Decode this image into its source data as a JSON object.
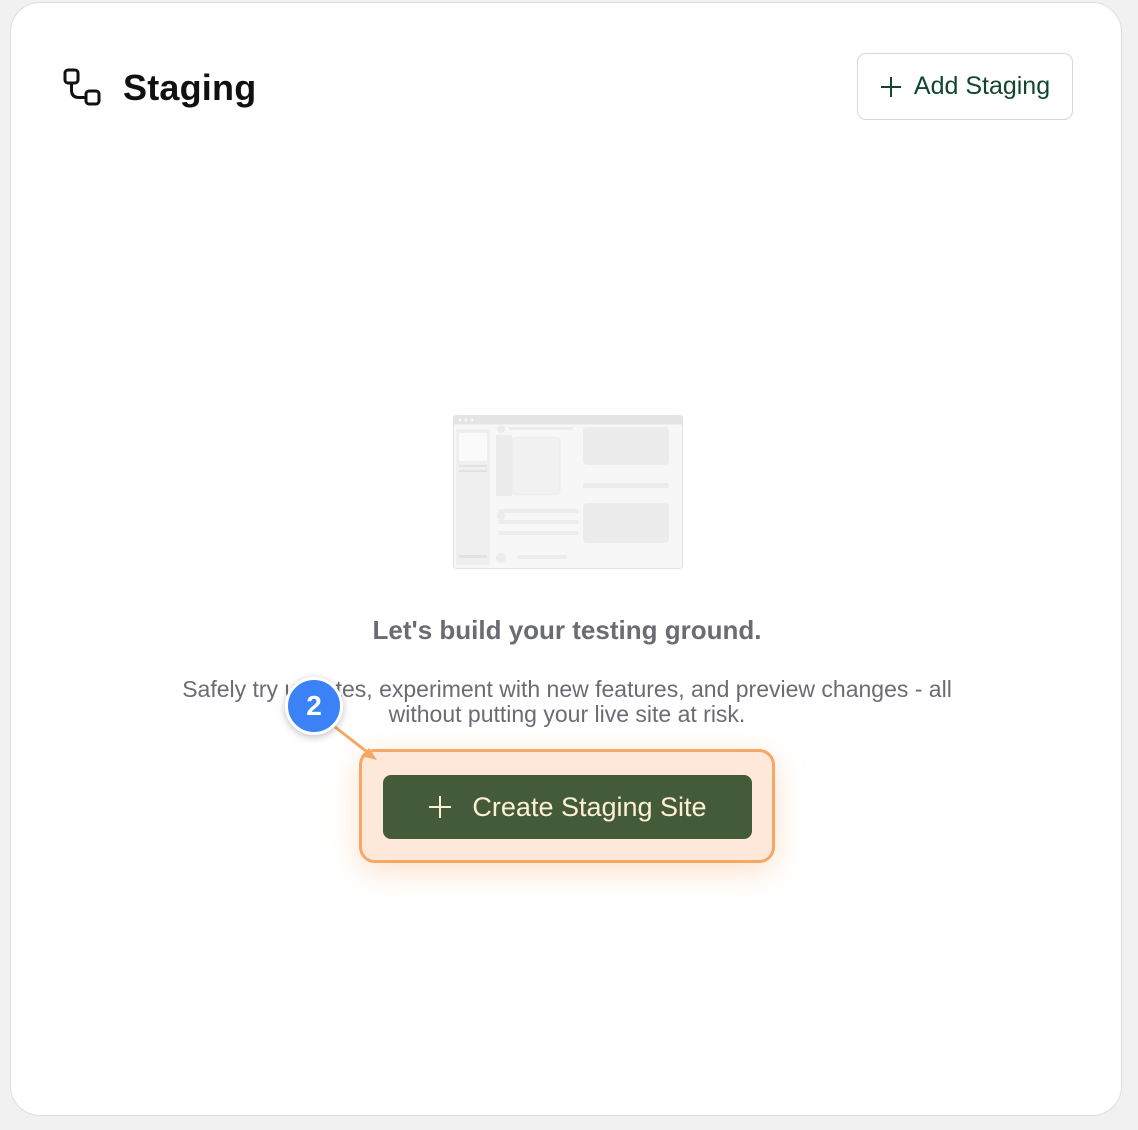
{
  "header": {
    "title": "Staging",
    "title_icon": "staging-nodes-icon",
    "add_button_label": "Add Staging"
  },
  "empty_state": {
    "illustration": "browser-window-placeholder",
    "headline": "Let's build your testing ground.",
    "description_line1": "Safely try updates, experiment with new features, and preview changes - all",
    "description_line2": "without putting your live site at risk.",
    "create_button_label": "Create Staging Site"
  },
  "annotation": {
    "step_number": "2",
    "highlight_color": "#f5a766",
    "badge_color": "#3b82f6"
  },
  "colors": {
    "brand_green": "#445b3a",
    "add_label_green": "#12462d",
    "create_label": "#fdf0d4",
    "muted_text": "#6b6b73"
  }
}
